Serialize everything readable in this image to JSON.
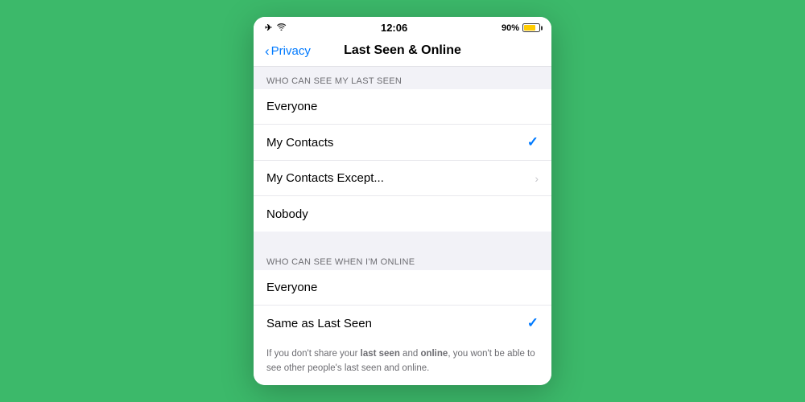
{
  "statusBar": {
    "time": "12:06",
    "battery": "90%",
    "icons": {
      "plane": "✈",
      "wifi": "wifi"
    }
  },
  "navBar": {
    "backLabel": "Privacy",
    "title": "Last Seen & Online"
  },
  "sections": [
    {
      "header": "WHO CAN SEE MY LAST SEEN",
      "rows": [
        {
          "label": "Everyone",
          "checked": false,
          "hasChevron": false
        },
        {
          "label": "My Contacts",
          "checked": true,
          "hasChevron": false
        },
        {
          "label": "My Contacts Except...",
          "checked": false,
          "hasChevron": true
        },
        {
          "label": "Nobody",
          "checked": false,
          "hasChevron": false
        }
      ]
    },
    {
      "header": "WHO CAN SEE WHEN I'M ONLINE",
      "rows": [
        {
          "label": "Everyone",
          "checked": false,
          "hasChevron": false
        },
        {
          "label": "Same as Last Seen",
          "checked": true,
          "hasChevron": false
        }
      ]
    }
  ],
  "footer": {
    "text": "If you don't share your last seen and online, you won't be able to see other people's last seen and online.",
    "boldWords": [
      "last seen",
      "online"
    ]
  }
}
